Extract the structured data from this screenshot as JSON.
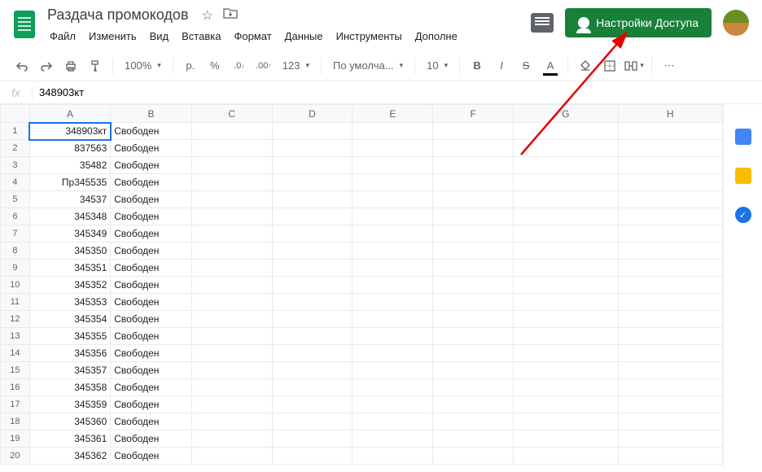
{
  "doc": {
    "title": "Раздача промокодов"
  },
  "menu": {
    "file": "Файл",
    "edit": "Изменить",
    "view": "Вид",
    "insert": "Вставка",
    "format": "Формат",
    "data": "Данные",
    "tools": "Инструменты",
    "more": "Дополне"
  },
  "share_button_label": "Настройки Доступа",
  "toolbar": {
    "zoom": "100%",
    "currency": "р.",
    "percent": "%",
    "dec_dec": ".0",
    "dec_inc": ".00",
    "numfmt": "123",
    "font": "По умолча...",
    "size": "10",
    "bold": "B",
    "italic": "I",
    "strike": "S",
    "textcolor": "A"
  },
  "formula": {
    "fx": "fx",
    "value": "348903кт"
  },
  "columns": [
    "A",
    "B",
    "C",
    "D",
    "E",
    "F",
    "G",
    "H"
  ],
  "rows": [
    {
      "n": 1,
      "a": "348903кт",
      "b": "Свободен"
    },
    {
      "n": 2,
      "a": "837563",
      "b": "Свободен"
    },
    {
      "n": 3,
      "a": "35482",
      "b": "Свободен"
    },
    {
      "n": 4,
      "a": "Пр345535",
      "b": "Свободен"
    },
    {
      "n": 5,
      "a": "34537",
      "b": "Свободен"
    },
    {
      "n": 6,
      "a": "345348",
      "b": "Свободен"
    },
    {
      "n": 7,
      "a": "345349",
      "b": "Свободен"
    },
    {
      "n": 8,
      "a": "345350",
      "b": "Свободен"
    },
    {
      "n": 9,
      "a": "345351",
      "b": "Свободен"
    },
    {
      "n": 10,
      "a": "345352",
      "b": "Свободен"
    },
    {
      "n": 11,
      "a": "345353",
      "b": "Свободен"
    },
    {
      "n": 12,
      "a": "345354",
      "b": "Свободен"
    },
    {
      "n": 13,
      "a": "345355",
      "b": "Свободен"
    },
    {
      "n": 14,
      "a": "345356",
      "b": "Свободен"
    },
    {
      "n": 15,
      "a": "345357",
      "b": "Свободен"
    },
    {
      "n": 16,
      "a": "345358",
      "b": "Свободен"
    },
    {
      "n": 17,
      "a": "345359",
      "b": "Свободен"
    },
    {
      "n": 18,
      "a": "345360",
      "b": "Свободен"
    },
    {
      "n": 19,
      "a": "345361",
      "b": "Свободен"
    },
    {
      "n": 20,
      "a": "345362",
      "b": "Свободен"
    }
  ]
}
